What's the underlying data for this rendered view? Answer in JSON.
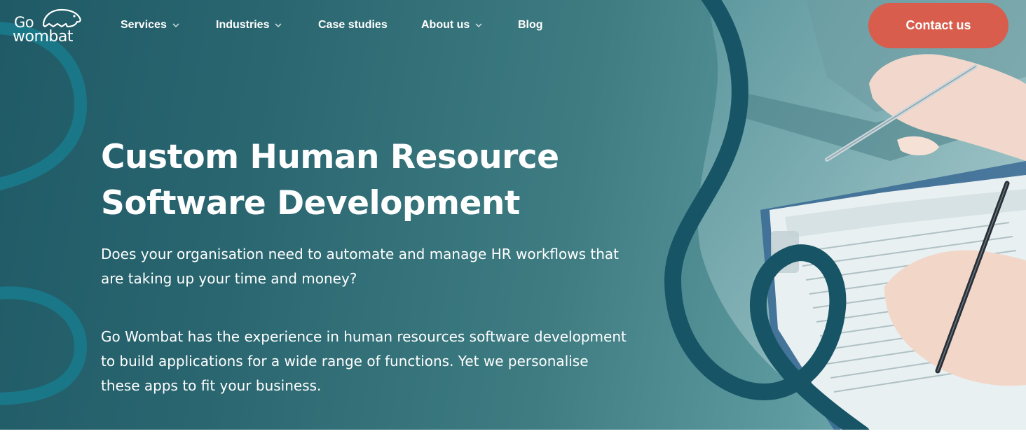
{
  "brand": {
    "line1": "Go",
    "line2": "wombat",
    "mascot_icon": "wombat-icon"
  },
  "nav": {
    "items": [
      {
        "label": "Services",
        "has_dropdown": true
      },
      {
        "label": "Industries",
        "has_dropdown": true
      },
      {
        "label": "Case studies",
        "has_dropdown": false
      },
      {
        "label": "About us",
        "has_dropdown": true
      },
      {
        "label": "Blog",
        "has_dropdown": false
      }
    ],
    "dropdown_icon": "chevron-down-icon"
  },
  "cta": {
    "label": "Contact us",
    "color": "#d85d4d"
  },
  "hero": {
    "title_line1": "Custom Human Resource",
    "title_line2": "Software Development",
    "paragraph1_line1": "Does your organisation need to automate and manage HR workflows that",
    "paragraph1_line2": "are taking up your time and money?",
    "paragraph2_line1": "Go Wombat has the experience in human resources software development",
    "paragraph2_line2": "to build applications for a wide range of functions. Yet we personalise",
    "paragraph2_line3": "these apps to fit your business."
  },
  "colors": {
    "hero_bg_dark": "#1f5a66",
    "hero_bg_light": "#8fbcc0",
    "decor_curve": "#1a7a8c",
    "decor_ribbon": "#175465",
    "text": "#ffffff"
  }
}
